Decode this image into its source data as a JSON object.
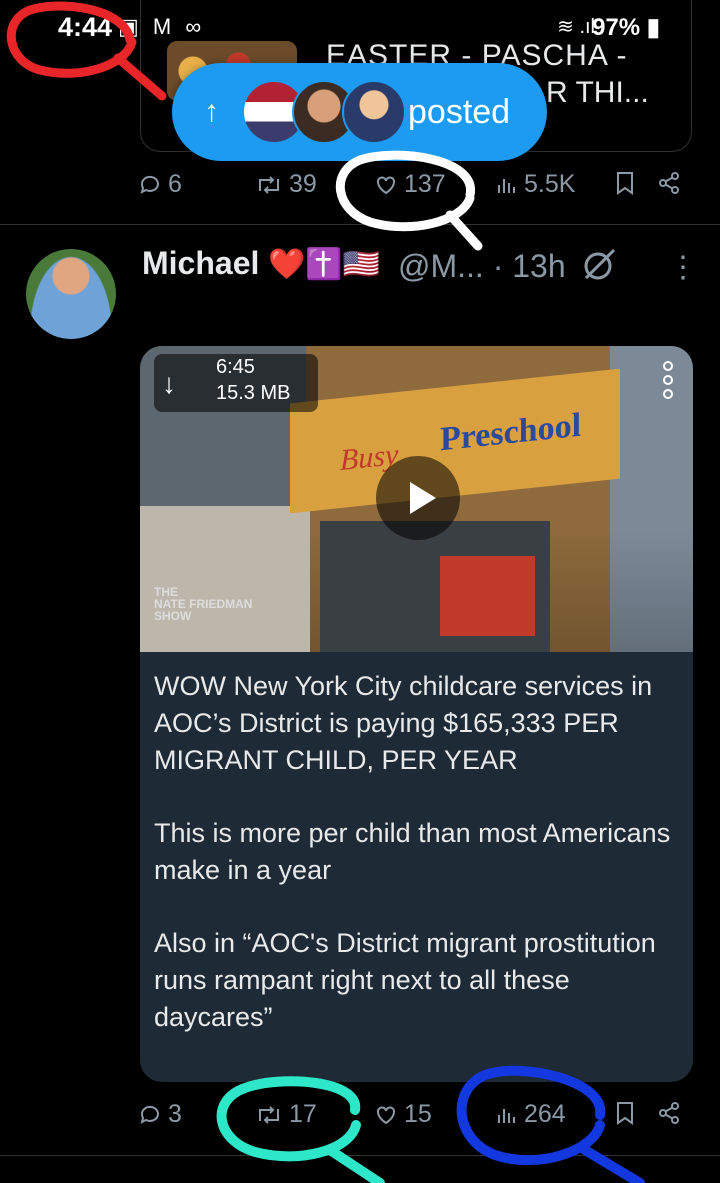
{
  "status_bar": {
    "time": "4:44",
    "left_icons": "▣ M ∞",
    "right_icons": "≋ .ıl",
    "battery": "97%"
  },
  "prev_post": {
    "quote_title_line1": "EASTER - PASCHA -",
    "quote_title_line2": "R THI...",
    "replies": "6",
    "reposts": "39",
    "likes": "137",
    "views": "5.5K"
  },
  "posted_pill": {
    "label": "posted"
  },
  "post": {
    "name": "Michael",
    "emoji": "❤️✝️🇺🇸",
    "handle": "@M...",
    "time": "· 13h",
    "media": {
      "duration": "6:45",
      "size": "15.3 MB",
      "sign_text": "Preschool",
      "sign_text2": "Busy",
      "watermark_line1": "THE",
      "watermark_line2": "NATE FRIEDMAN",
      "watermark_line3": "SHOW"
    },
    "body": [
      "WOW  New York City childcare services in AOC’s District is paying $165,333 PER MIGRANT CHILD, PER YEAR",
      "This is more per child than most Americans make in a year",
      "Also in “AOC's District migrant prostitution runs rampant right next to all these daycares”"
    ],
    "replies": "3",
    "reposts": "17",
    "likes": "15",
    "views": "264"
  },
  "colors": {
    "accent": "#1d9bf0",
    "annotation_red": "#e8262a",
    "annotation_white": "#ffffff",
    "annotation_teal": "#2ee6c8",
    "annotation_blue": "#1338e0"
  }
}
